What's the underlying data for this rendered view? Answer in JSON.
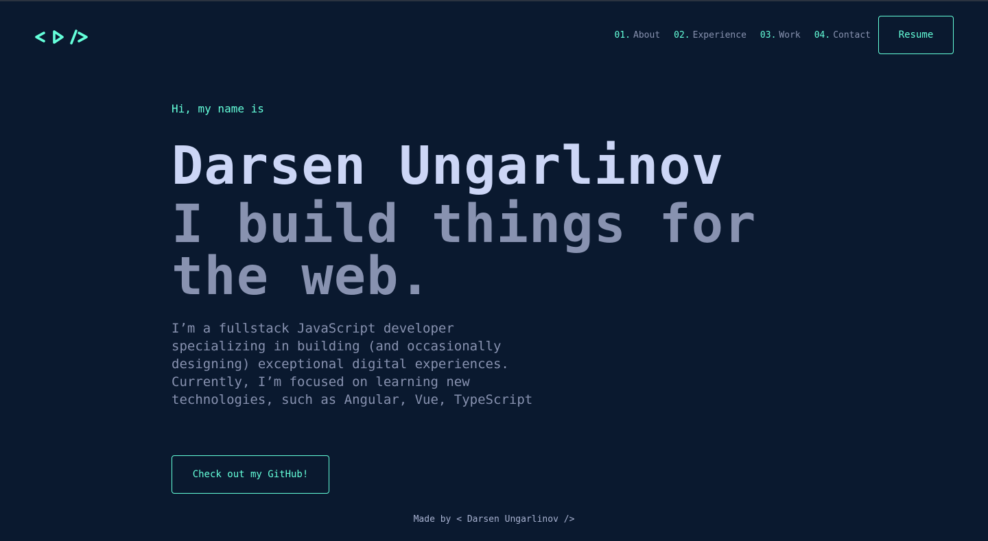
{
  "colors": {
    "background": "#0a192f",
    "accent": "#64ffda",
    "heading": "#ccd6f6",
    "text": "#8892b0"
  },
  "header": {
    "logo_icon": "code-brackets-logo",
    "nav": [
      {
        "num": "01.",
        "label": "About"
      },
      {
        "num": "02.",
        "label": "Experience"
      },
      {
        "num": "03.",
        "label": "Work"
      },
      {
        "num": "04.",
        "label": "Contact"
      }
    ],
    "resume_label": "Resume"
  },
  "hero": {
    "greeting": "Hi, my name is",
    "name": "Darsen Ungarlinov",
    "tagline": "I build things for the web.",
    "bio": "I’m a fullstack JavaScript developer specializing in building (and occasionally designing) exceptional digital experiences. Currently, I’m focused on learning new technologies, such as Angular, Vue, TypeScript",
    "cta_label": "Check out my GitHub!"
  },
  "footer": {
    "text": "Made by < Darsen Ungarlinov />"
  }
}
